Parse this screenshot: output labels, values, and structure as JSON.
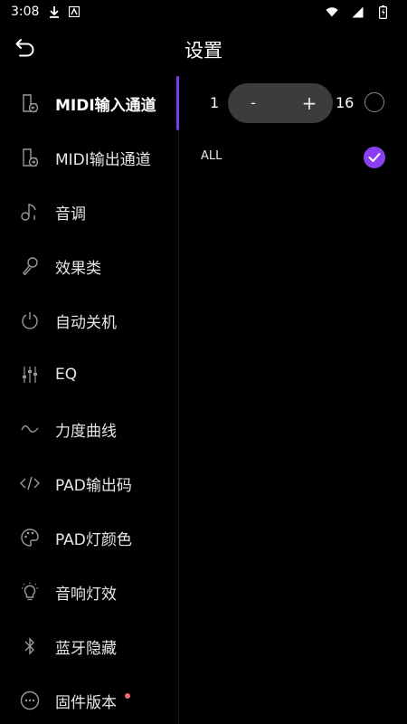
{
  "status_bar": {
    "time": "3:08",
    "icons": [
      "download-icon",
      "app-notification-icon",
      "wifi-icon",
      "signal-icon",
      "battery-icon"
    ]
  },
  "header": {
    "title": "设置",
    "back_icon": "back-arrow-icon"
  },
  "sidebar": {
    "items": [
      {
        "label": "MIDI输入通道",
        "icon": "midi-in-icon",
        "active": true
      },
      {
        "label": "MIDI输出通道",
        "icon": "midi-out-icon",
        "active": false
      },
      {
        "label": "音调",
        "icon": "music-note-icon",
        "active": false
      },
      {
        "label": "效果类",
        "icon": "microphone-icon",
        "active": false
      },
      {
        "label": "自动关机",
        "icon": "power-icon",
        "active": false
      },
      {
        "label": "EQ",
        "icon": "equalizer-icon",
        "active": false
      },
      {
        "label": "力度曲线",
        "icon": "curve-icon",
        "active": false
      },
      {
        "label": "PAD输出码",
        "icon": "code-icon",
        "active": false
      },
      {
        "label": "PAD灯颜色",
        "icon": "palette-icon",
        "active": false
      },
      {
        "label": "音响灯效",
        "icon": "lightbulb-icon",
        "active": false
      },
      {
        "label": "蓝牙隐藏",
        "icon": "bluetooth-icon",
        "active": false
      },
      {
        "label": "固件版本",
        "icon": "firmware-icon",
        "active": false,
        "has_badge": true
      }
    ]
  },
  "content": {
    "channel_range": {
      "min_label": "1",
      "minus_label": "-",
      "plus_label": "+",
      "max_label": "16",
      "selected": false
    },
    "all_option": {
      "label": "ALL",
      "selected": true
    }
  },
  "colors": {
    "background": "#000000",
    "accent": "#8a3ff0",
    "stepper_bg": "#3c3c3c",
    "badge": "#f26a6a"
  }
}
